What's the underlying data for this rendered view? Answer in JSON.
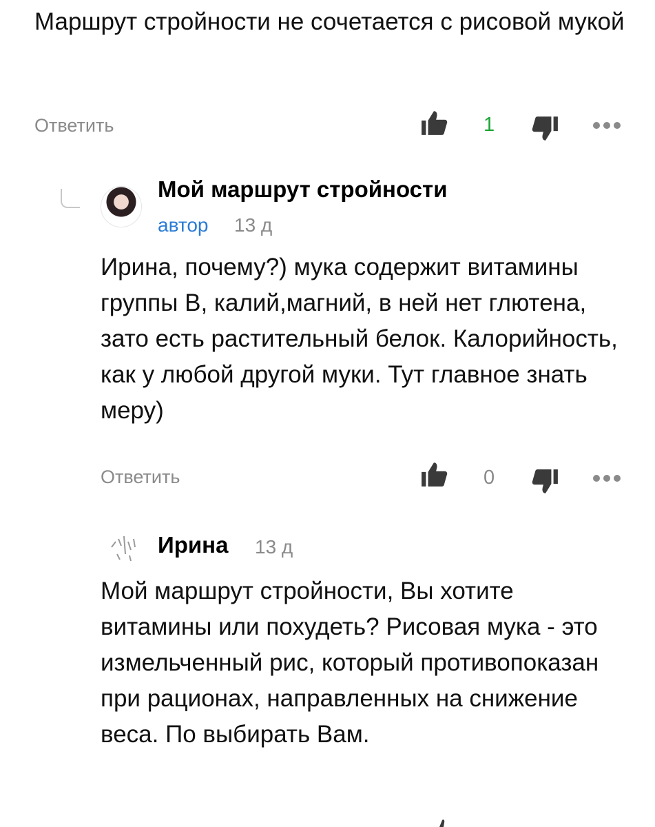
{
  "comments": [
    {
      "text": "Маршрут стройности не сочетается с рисовой мукой",
      "reply_label": "Ответить",
      "likes": "1",
      "like_color": "#1aa534"
    },
    {
      "author": "Мой маршрут стройности",
      "badge": "автор",
      "time": "13 д",
      "text": "Ирина, почему?) мука содержит витамины группы В, калий,магний, в ней нет глютена, зато есть растительный белок. Калорийность, как у любой другой муки. Тут главное знать меру)",
      "reply_label": "Ответить",
      "likes": "0"
    },
    {
      "author": "Ирина",
      "time": "13 д",
      "text": "Мой маршрут стройности, Вы хотите витамины или похудеть? Рисовая мука - это измельченный рис, который противопоказан при рационах, направленных на снижение веса. По выбирать Вам."
    }
  ],
  "icons": {
    "like": "thumbs-up-icon",
    "dislike": "thumbs-down-icon",
    "more": "more-dots-icon",
    "thread": "reply-thread-icon"
  },
  "colors": {
    "muted": "#8a8a8a",
    "accent_badge": "#2a7bd4"
  }
}
